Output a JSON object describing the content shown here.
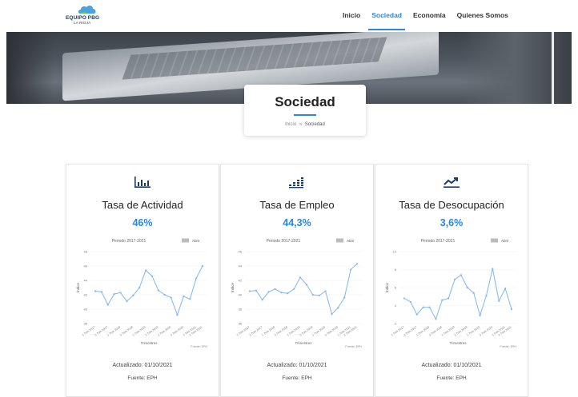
{
  "header": {
    "logo_text": "EQUIPO PBG",
    "logo_sub": "LA RIOJA",
    "nav": [
      {
        "label": "Inicio",
        "active": false
      },
      {
        "label": "Sociedad",
        "active": true
      },
      {
        "label": "Economía",
        "active": false
      },
      {
        "label": "Quienes Somos",
        "active": false
      }
    ]
  },
  "page": {
    "title": "Sociedad",
    "breadcrumb": {
      "home": "Inicio",
      "separator": "»",
      "current": "Sociedad"
    }
  },
  "colors": {
    "accent": "#2b86de",
    "line": "#7fb8ea",
    "text": "#222222"
  },
  "cards": [
    {
      "icon": "bar-chart-icon",
      "title": "Tasa de Actividad",
      "value": "46%",
      "updated": "Actualizado: 01/10/2021",
      "source": "Fuente: EPH"
    },
    {
      "icon": "equalizer-icon",
      "title": "Tasa de Empleo",
      "value": "44,3%",
      "updated": "Actualizado: 01/10/2021",
      "source": "Fuente: EPH"
    },
    {
      "icon": "trend-chart-icon",
      "title": "Tasa de Desocupación",
      "value": "3,6%",
      "updated": "Actualizado: 01/10/2021",
      "source": "Fuente: EPH"
    }
  ],
  "chart_data": [
    {
      "type": "line",
      "title": "Periodo 2017-2021",
      "legend": [
        "Abrir"
      ],
      "xlabel": "Trimestres",
      "ylabel": "Índice",
      "note": "Fuente: EPH",
      "ylim": [
        38,
        48
      ],
      "yticks": [
        38,
        40,
        42,
        44,
        46,
        48
      ],
      "x": [
        "1 Trim 2017",
        "2 Trim 2017",
        "3 Trim 2017",
        "4 Trim 2017",
        "1 Trim 2018",
        "2 Trim 2018",
        "3 Trim 2018",
        "4 Trim 2018",
        "1 Trim 2019",
        "2 Trim 2019",
        "3 Trim 2019",
        "4 Trim 2019",
        "1 Trim 2020",
        "2 Trim 2020",
        "3 Trim 2020",
        "4 Trim 2020",
        "1 Trim 2021",
        "2 Trim 2021"
      ],
      "xtick_labels": [
        "1 Trim 2017",
        "3 Trim 2017",
        "1 Trim 2018",
        "3 Trim 2018",
        "1 Trim 2019",
        "3 Trim 2019",
        "1 Trim 2020",
        "3 Trim 2020",
        "1 Trim 2021",
        "2 Trim 2021"
      ],
      "values": [
        42.5,
        42.4,
        40.6,
        42.1,
        42.3,
        41.1,
        41.9,
        43.0,
        45.4,
        44.6,
        42.6,
        42.0,
        41.6,
        39.2,
        41.8,
        41.4,
        44.3,
        46.0
      ]
    },
    {
      "type": "line",
      "title": "Periodo 2017-2021",
      "legend": [
        "Abrir"
      ],
      "xlabel": "Trimestres",
      "ylabel": "Índice",
      "note": "Fuente: EPH",
      "ylim": [
        36,
        46
      ],
      "yticks": [
        36,
        38,
        40,
        42,
        44,
        46
      ],
      "x": [
        "1 Trim 2017",
        "2 Trim 2017",
        "3 Trim 2017",
        "4 Trim 2017",
        "1 Trim 2018",
        "2 Trim 2018",
        "3 Trim 2018",
        "4 Trim 2018",
        "1 Trim 2019",
        "2 Trim 2019",
        "3 Trim 2019",
        "4 Trim 2019",
        "1 Trim 2020",
        "2 Trim 2020",
        "3 Trim 2020",
        "4 Trim 2020",
        "1 Trim 2021",
        "2 Trim 2021"
      ],
      "xtick_labels": [
        "1 Trim 2017",
        "3 Trim 2017",
        "1 Trim 2018",
        "3 Trim 2018",
        "1 Trim 2019",
        "3 Trim 2019",
        "1 Trim 2020",
        "3 Trim 2020",
        "1 Trim 2021",
        "2 Trim 2021"
      ],
      "values": [
        40.5,
        40.6,
        39.3,
        40.4,
        40.8,
        40.3,
        40.2,
        40.8,
        42.4,
        41.4,
        40.0,
        39.9,
        40.5,
        37.3,
        38.2,
        39.6,
        43.5,
        44.3
      ]
    },
    {
      "type": "line",
      "title": "Periodo 2017-2021",
      "legend": [
        "Abrir"
      ],
      "xlabel": "Trimestres",
      "ylabel": "Índice",
      "note": "Fuente: EPH",
      "ylim": [
        2,
        10
      ],
      "yticks": [
        2,
        4,
        6,
        8,
        10
      ],
      "x": [
        "1 Trim 2017",
        "2 Trim 2017",
        "3 Trim 2017",
        "4 Trim 2017",
        "1 Trim 2018",
        "2 Trim 2018",
        "3 Trim 2018",
        "4 Trim 2018",
        "1 Trim 2019",
        "2 Trim 2019",
        "3 Trim 2019",
        "4 Trim 2019",
        "1 Trim 2020",
        "2 Trim 2020",
        "3 Trim 2020",
        "4 Trim 2020",
        "1 Trim 2021",
        "2 Trim 2021"
      ],
      "xtick_labels": [
        "1 Trim 2017",
        "3 Trim 2017",
        "1 Trim 2018",
        "3 Trim 2018",
        "1 Trim 2019",
        "3 Trim 2019",
        "1 Trim 2020",
        "3 Trim 2020",
        "1 Trim 2021",
        "2 Trim 2021"
      ],
      "values": [
        4.8,
        4.4,
        3.0,
        3.8,
        3.8,
        2.5,
        4.6,
        4.8,
        6.9,
        7.4,
        6.0,
        5.4,
        2.9,
        5.1,
        8.1,
        4.5,
        5.9,
        3.6
      ]
    }
  ]
}
